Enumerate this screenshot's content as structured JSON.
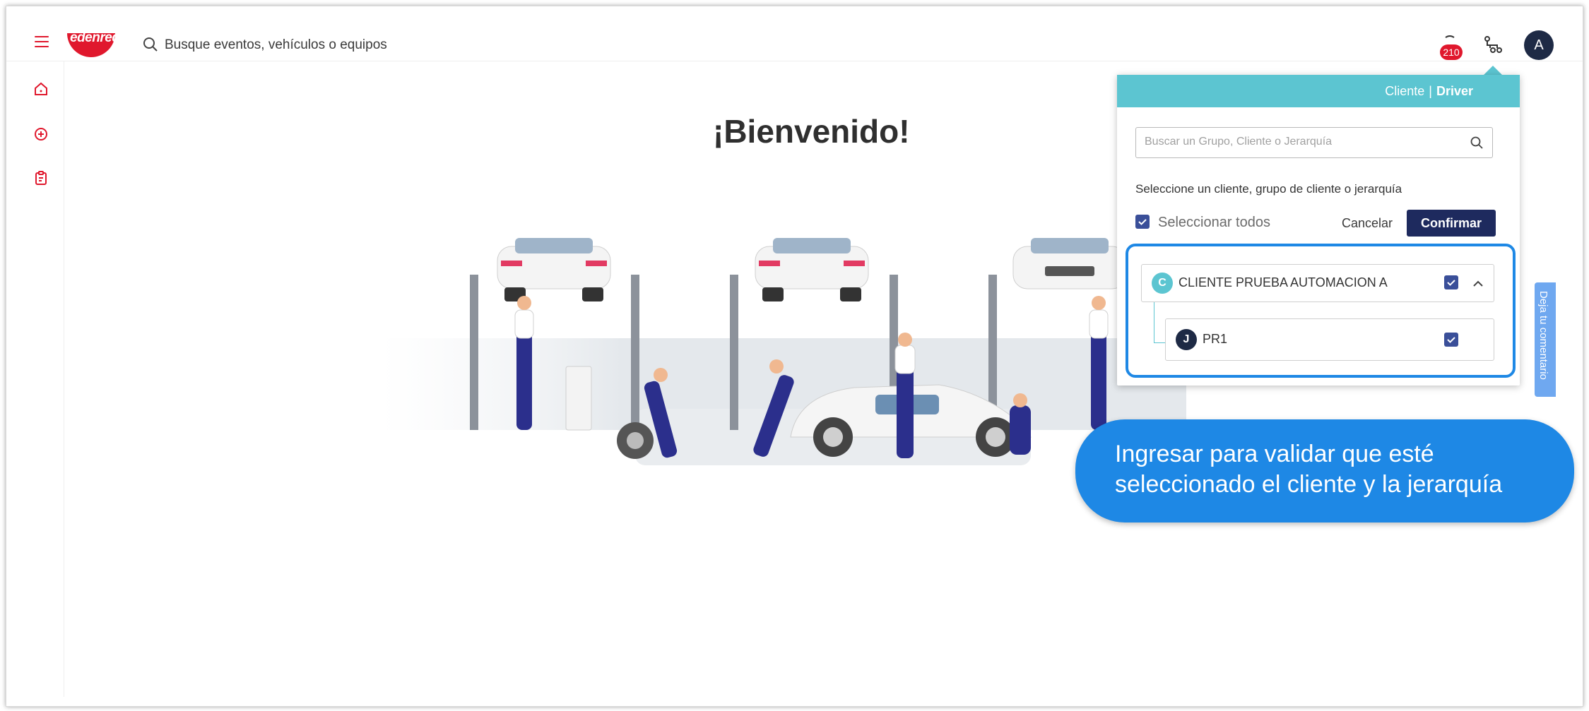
{
  "header": {
    "logo": "edenred",
    "search_placeholder": "Busque eventos, vehículos o equipos",
    "notification_count": "210",
    "avatar_letter": "A"
  },
  "main": {
    "welcome_title": "¡Bienvenido!"
  },
  "panel": {
    "tab_cliente": "Cliente",
    "tab_separator": "|",
    "tab_driver": "Driver",
    "search_placeholder": "Buscar un Grupo, Cliente o Jerarquía",
    "prompt": "Seleccione un cliente, grupo de cliente o jerarquía",
    "select_all_label": "Seleccionar todos",
    "select_all_checked": true,
    "cancel_label": "Cancelar",
    "confirm_label": "Confirmar",
    "tree": [
      {
        "avatar": "C",
        "label": "CLIENTE PRUEBA AUTOMACION A",
        "checked": true,
        "expanded": true,
        "color": "#5cc5d1",
        "children": [
          {
            "avatar": "J",
            "label": "PR1",
            "checked": true,
            "color": "#1e2a45"
          }
        ]
      }
    ]
  },
  "callout": {
    "line1": "Ingresar para validar que esté",
    "line2": "seleccionado el cliente y la jerarquía"
  },
  "side_tab": {
    "label": "Deja tu comentario"
  },
  "colors": {
    "brand_red": "#e0182d",
    "panel_header": "#5cc5d1",
    "confirm_button": "#1e2a5e",
    "checkbox": "#3a4f99",
    "callout": "#1e88e5"
  }
}
